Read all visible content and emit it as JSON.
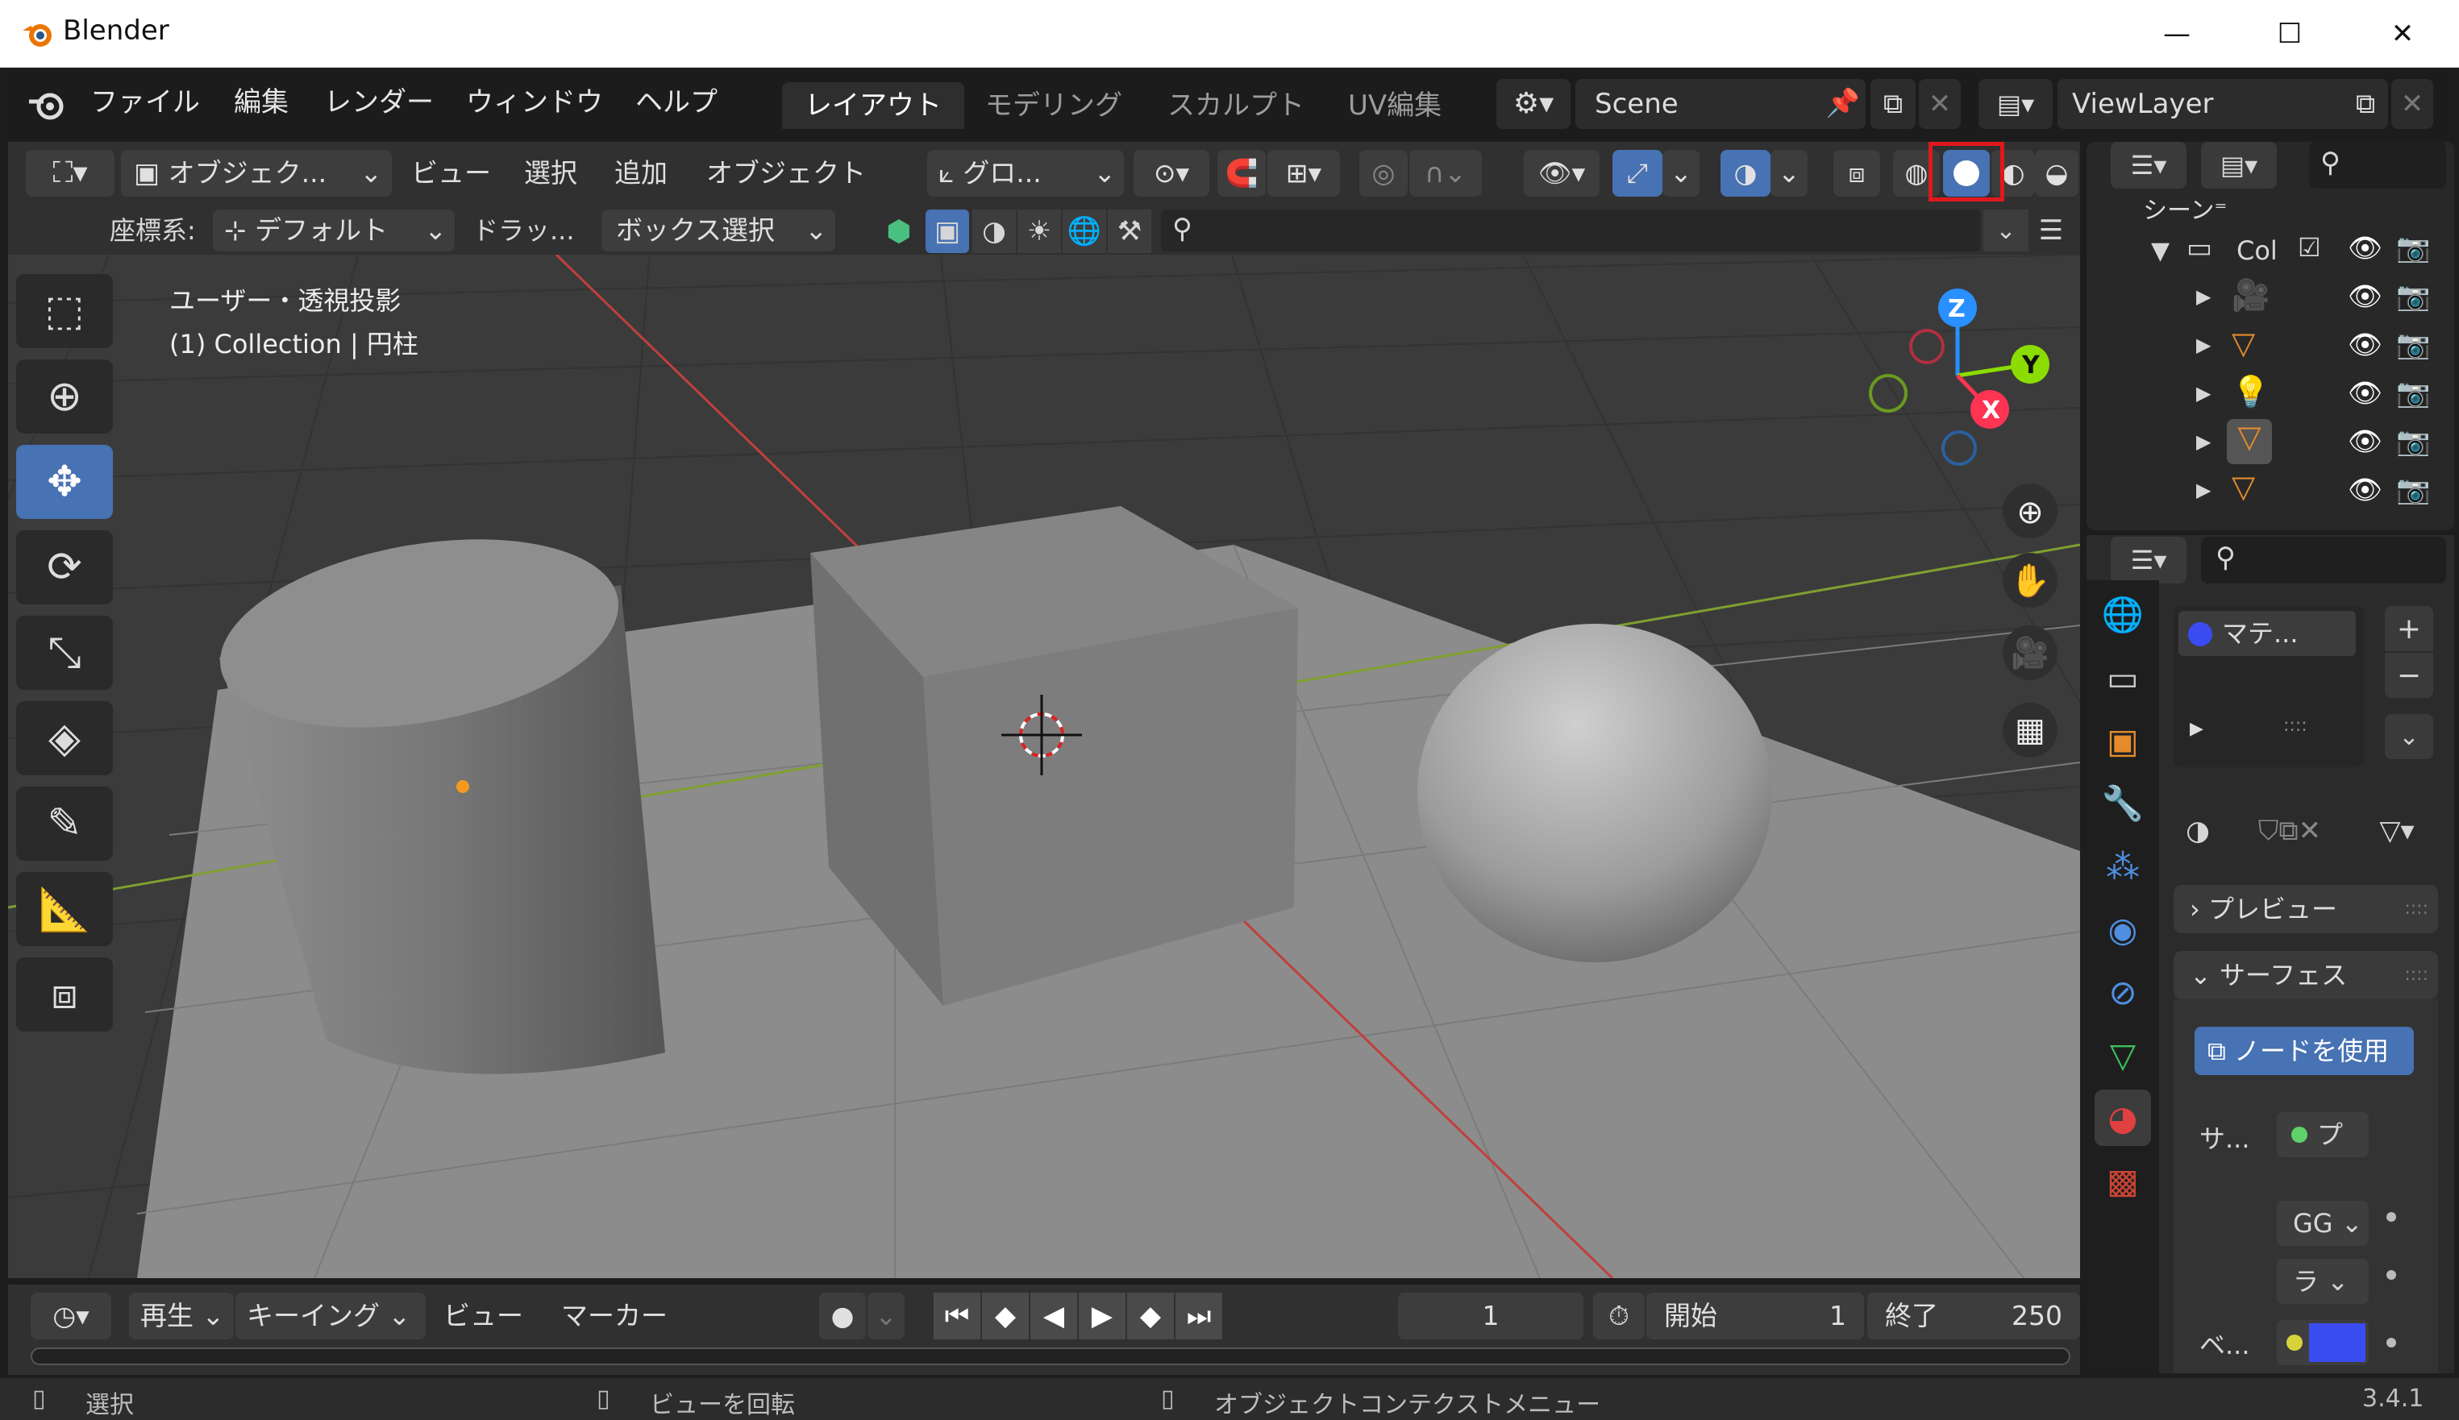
{
  "window": {
    "title": "Blender",
    "min": "—",
    "max": "☐",
    "close": "✕"
  },
  "menu": {
    "items": [
      "ファイル",
      "編集",
      "レンダー",
      "ウィンドウ",
      "ヘルプ"
    ]
  },
  "workspaces": {
    "tabs": [
      "レイアウト",
      "モデリング",
      "スカルプト",
      "UV編集"
    ],
    "active": "レイアウト"
  },
  "scene": {
    "name": "Scene",
    "view_layer": "ViewLayer"
  },
  "viewport_header": {
    "mode": "オブジェク...",
    "menus": [
      "ビュー",
      "選択",
      "追加",
      "オブジェクト"
    ],
    "transform_orientation": "グロ...",
    "coord_label": "座標系:",
    "coord_value": "デフォルト",
    "drag_label": "ドラッ...",
    "select_mode": "ボックス選択"
  },
  "viewport": {
    "view_name": "ユーザー・透視投影",
    "context": "(1) Collection | 円柱"
  },
  "gizmo": {
    "z": "Z",
    "y": "Y",
    "x": "X"
  },
  "outliner": {
    "scene_label": "シーン⁼",
    "collection": "Col"
  },
  "properties": {
    "material_slot": "マテ...",
    "preview": "プレビュー",
    "surface": "サーフェス",
    "use_nodes": "ノードを使用",
    "surface_label": "サ...",
    "surface_value": "プ",
    "gg": "GG",
    "ra": "ラ",
    "base_label": "ベ...",
    "base_color": "#3a4cf0",
    "grip": "::::",
    "ruler": ":::::"
  },
  "timeline": {
    "play": "再生",
    "keying": "キーイング",
    "view": "ビュー",
    "marker": "マーカー",
    "current_frame": "1",
    "start_label": "開始",
    "start": "1",
    "end_label": "終了",
    "end": "250"
  },
  "status": {
    "select": "選択",
    "rotate": "ビューを回転",
    "context_menu": "オブジェクトコンテクストメニュー",
    "version": "3.4.1"
  },
  "colors": {
    "accent": "#4772b3",
    "highlight_box": "#e0181e",
    "axis_x": "#ff3352",
    "axis_y": "#8bdc00",
    "axis_z": "#2890ff"
  }
}
